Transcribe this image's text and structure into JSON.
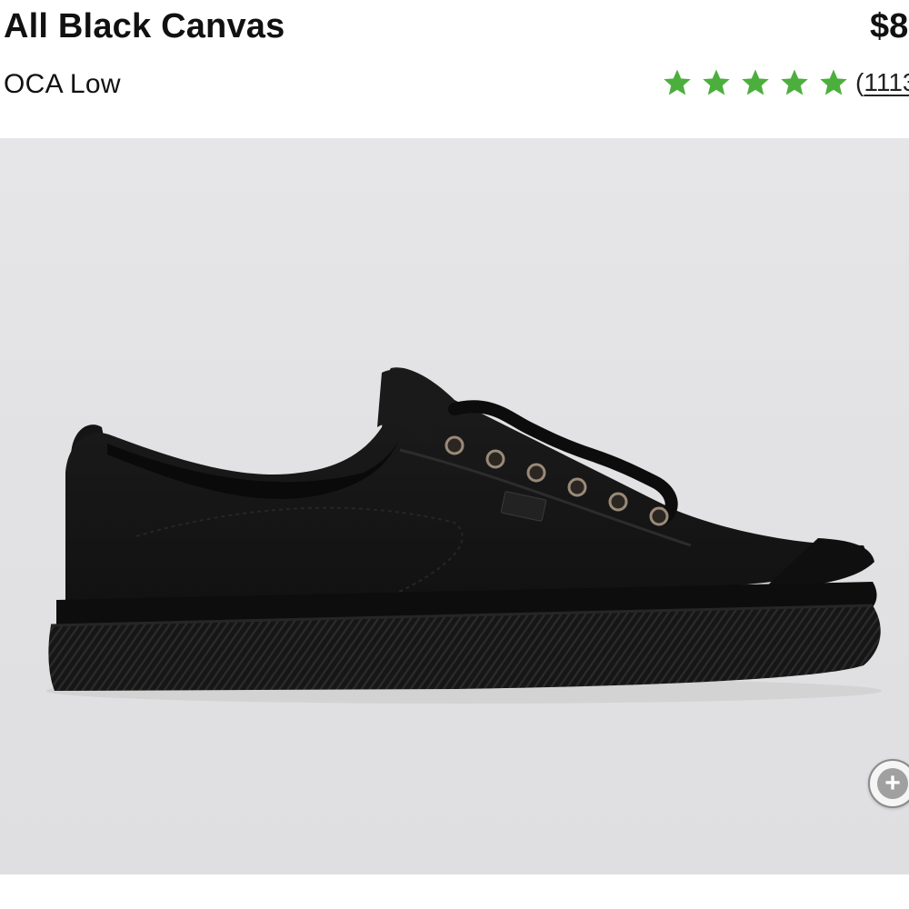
{
  "product": {
    "name": "All Black Canvas",
    "model": "OCA Low",
    "price": "$8",
    "rating": {
      "stars": 5,
      "review_count_open": "(",
      "review_count": "1113"
    }
  },
  "image": {
    "alt": "Black canvas low-top sneaker",
    "zoom_icon": "zoom-plus-icon"
  },
  "colors": {
    "star": "#4caf3d",
    "image_bg": "#e2e2e4",
    "shoe": "#141414"
  }
}
